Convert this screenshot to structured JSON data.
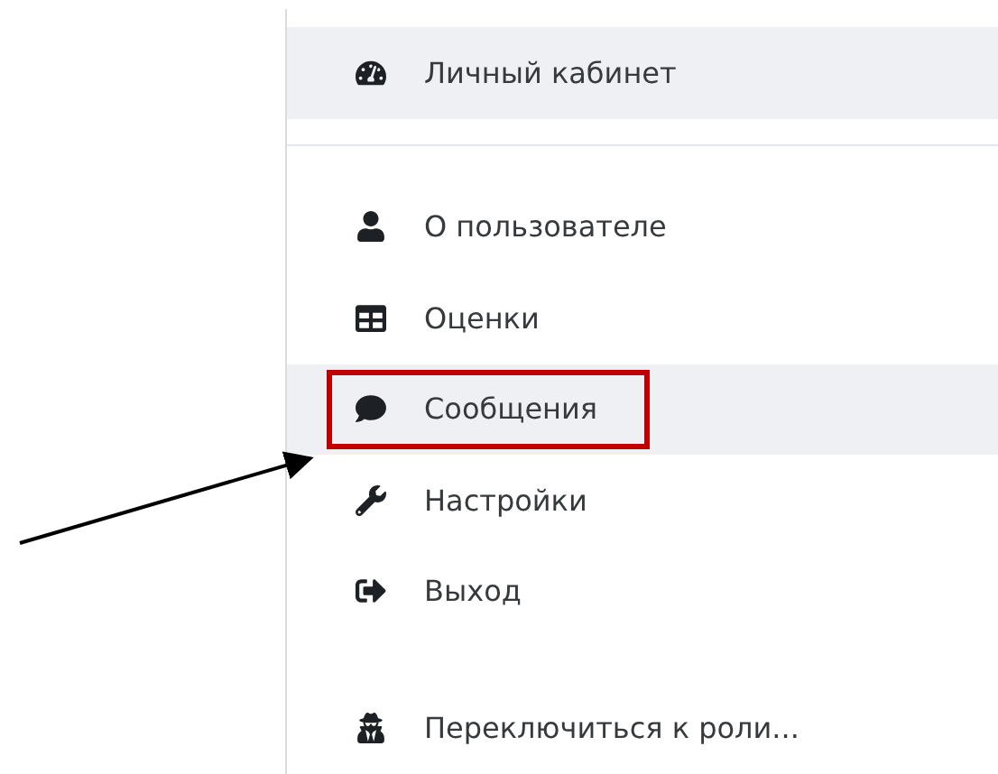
{
  "menu": [
    {
      "kind": "item",
      "label": "Личный кабинет",
      "highlighted": true,
      "marked": false
    },
    {
      "kind": "divider"
    },
    {
      "kind": "item",
      "label": "О пользователе",
      "highlighted": false,
      "marked": false
    },
    {
      "kind": "item",
      "label": "Оценки",
      "highlighted": false,
      "marked": false
    },
    {
      "kind": "item",
      "label": "Сообщения",
      "highlighted": true,
      "marked": true
    },
    {
      "kind": "item",
      "label": "Настройки",
      "highlighted": false,
      "marked": false
    },
    {
      "kind": "item",
      "label": "Выход",
      "highlighted": false,
      "marked": false
    },
    {
      "kind": "spacer"
    },
    {
      "kind": "item",
      "label": "Переключиться к роли...",
      "highlighted": false,
      "marked": false
    }
  ]
}
